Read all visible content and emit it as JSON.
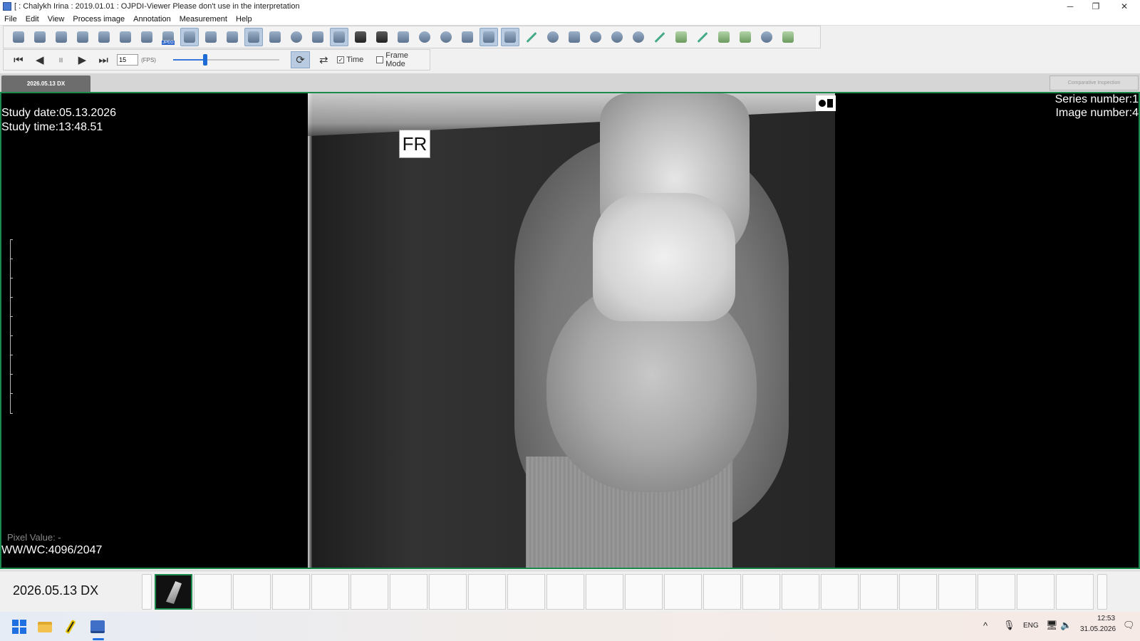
{
  "window": {
    "title": "[ : Chalykh Irina : 2019.01.01 : OJPDI-Viewer  Please don't use in the interpretation",
    "controls": {
      "minimize": "─",
      "restore": "❐",
      "close": "✕"
    }
  },
  "menu": [
    "File",
    "Edit",
    "View",
    "Process image",
    "Annotation",
    "Measurement",
    "Help"
  ],
  "toolbar": {
    "icons": [
      "open-icon",
      "link-icon",
      "user-icon",
      "user-share-icon",
      "stack-icon",
      "stack-alt-icon",
      "document-icon",
      "jpeg-export-icon",
      "grid-layout-icon",
      "copy-icon",
      "grid-icon",
      "patient-icon",
      "print-icon",
      "info-icon",
      "edit-icon",
      "hand-select-icon",
      "window-level-icon",
      "invert-icon",
      "pan-icon",
      "zoom-icon",
      "rotate-icon",
      "crop-icon",
      "compare-icon",
      "compare-alt-icon",
      "ruler-icon",
      "magnify-px-icon",
      "spine-icon",
      "skull-icon",
      "head-icon",
      "heart-icon",
      "line-icon",
      "text-annotation-icon",
      "pencil-icon",
      "angle-icon",
      "rectangle-icon",
      "ellipse-icon",
      "polygon-icon"
    ],
    "jpeg_label": "JPEG"
  },
  "playback": {
    "fps_value": "15",
    "fps_unit": "(FPS)",
    "slider_fraction": 0.3,
    "time_label": "Time",
    "time_checked": true,
    "frame_mode_label": "Frame Mode",
    "frame_mode_checked": false
  },
  "tabs": {
    "active": "2026.05.13 DX",
    "compare_button": "Comparative Inspection"
  },
  "overlay": {
    "study_date": "Study date:05.13.2026",
    "study_time": "Study time:13:48.51",
    "series_number": "Series number:1",
    "image_number": "Image number:4",
    "pixel_value": "Pixel Value:   -",
    "ww_wc": "WW/WC:4096/2047",
    "marker": "FR"
  },
  "thumbstrip": {
    "label": "2026.05.13 DX",
    "cell_count": 24,
    "active_index": 0
  },
  "taskbar": {
    "apps": [
      "start-icon",
      "file-explorer-icon",
      "pen-app-icon",
      "viewer-app-icon"
    ],
    "language": "ENG",
    "time": "12:53",
    "date": "31.05.2026",
    "chevron": "^"
  }
}
